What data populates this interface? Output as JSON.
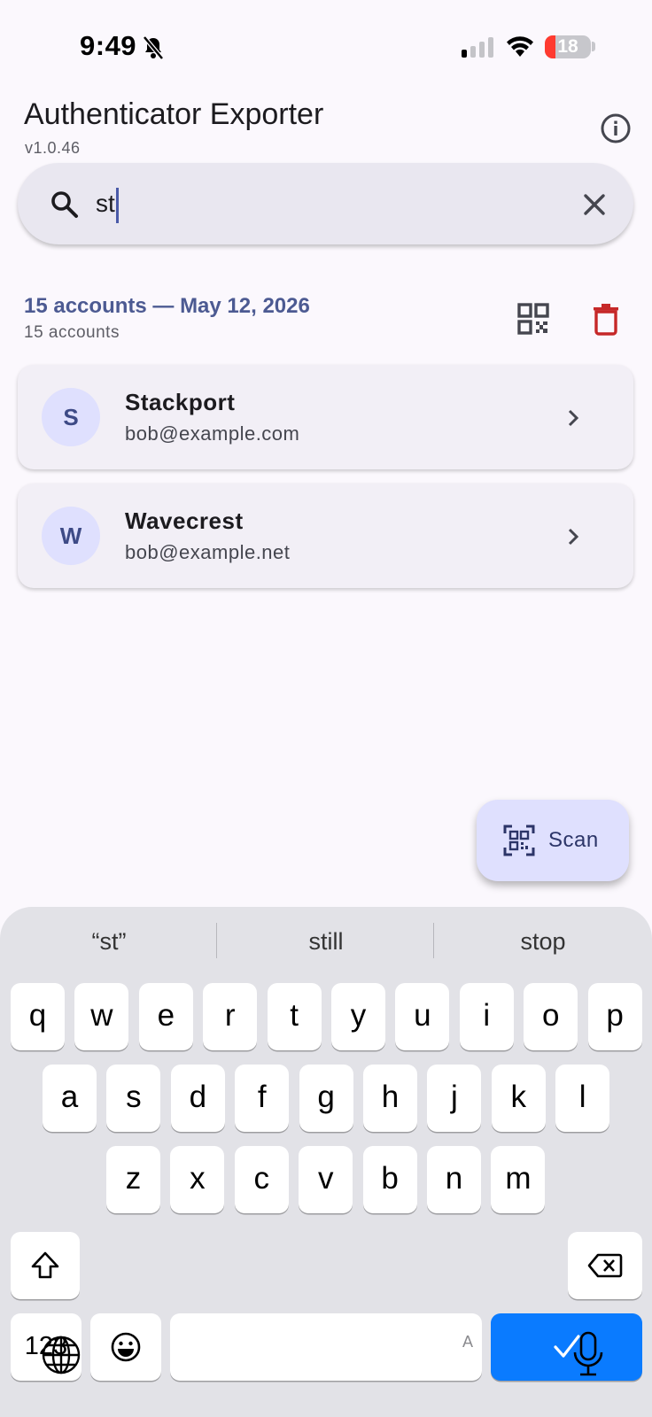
{
  "status_bar": {
    "time": "9:49",
    "battery": "18"
  },
  "header": {
    "title": "Authenticator Exporter",
    "version": "v1.0.46"
  },
  "search": {
    "value": "st",
    "placeholder": ""
  },
  "group": {
    "title": "15 accounts — May 12, 2026",
    "subtitle": "15 accounts"
  },
  "accounts": [
    {
      "initial": "S",
      "name": "Stackport",
      "email": "bob@example.com"
    },
    {
      "initial": "W",
      "name": "Wavecrest",
      "email": "bob@example.net"
    }
  ],
  "fab": {
    "label": "Scan"
  },
  "keyboard": {
    "suggestions": [
      "“st”",
      "still",
      "stop"
    ],
    "row1": [
      "q",
      "w",
      "e",
      "r",
      "t",
      "y",
      "u",
      "i",
      "o",
      "p"
    ],
    "row2": [
      "a",
      "s",
      "d",
      "f",
      "g",
      "h",
      "j",
      "k",
      "l"
    ],
    "row3": [
      "z",
      "x",
      "c",
      "v",
      "b",
      "n",
      "m"
    ],
    "numbers_key": "123",
    "space_hint": "A"
  },
  "colors": {
    "accent": "#4c5a92",
    "delete": "#c62828",
    "done_key": "#0a7bff"
  }
}
